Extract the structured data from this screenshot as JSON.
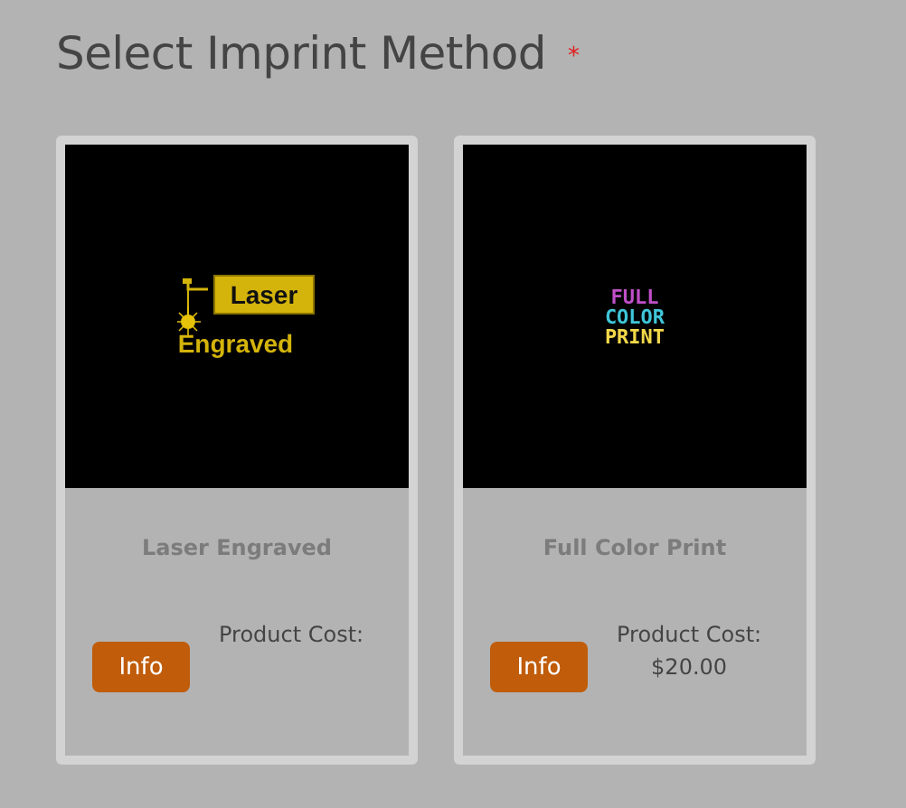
{
  "title": "Select Imprint Method",
  "required_mark": "*",
  "methods": [
    {
      "name": "Laser Engraved",
      "logo": {
        "kind": "laser",
        "lines": [
          "Laser",
          "Engraved"
        ]
      },
      "button": "Info",
      "cost_label": "Product Cost:"
    },
    {
      "name": "Full Color Print",
      "logo": {
        "kind": "color",
        "lines": [
          "FULL",
          "COLOR",
          "PRINT"
        ]
      },
      "button": "Info",
      "cost_label": "Product Cost:",
      "cost": "$20.00"
    }
  ]
}
